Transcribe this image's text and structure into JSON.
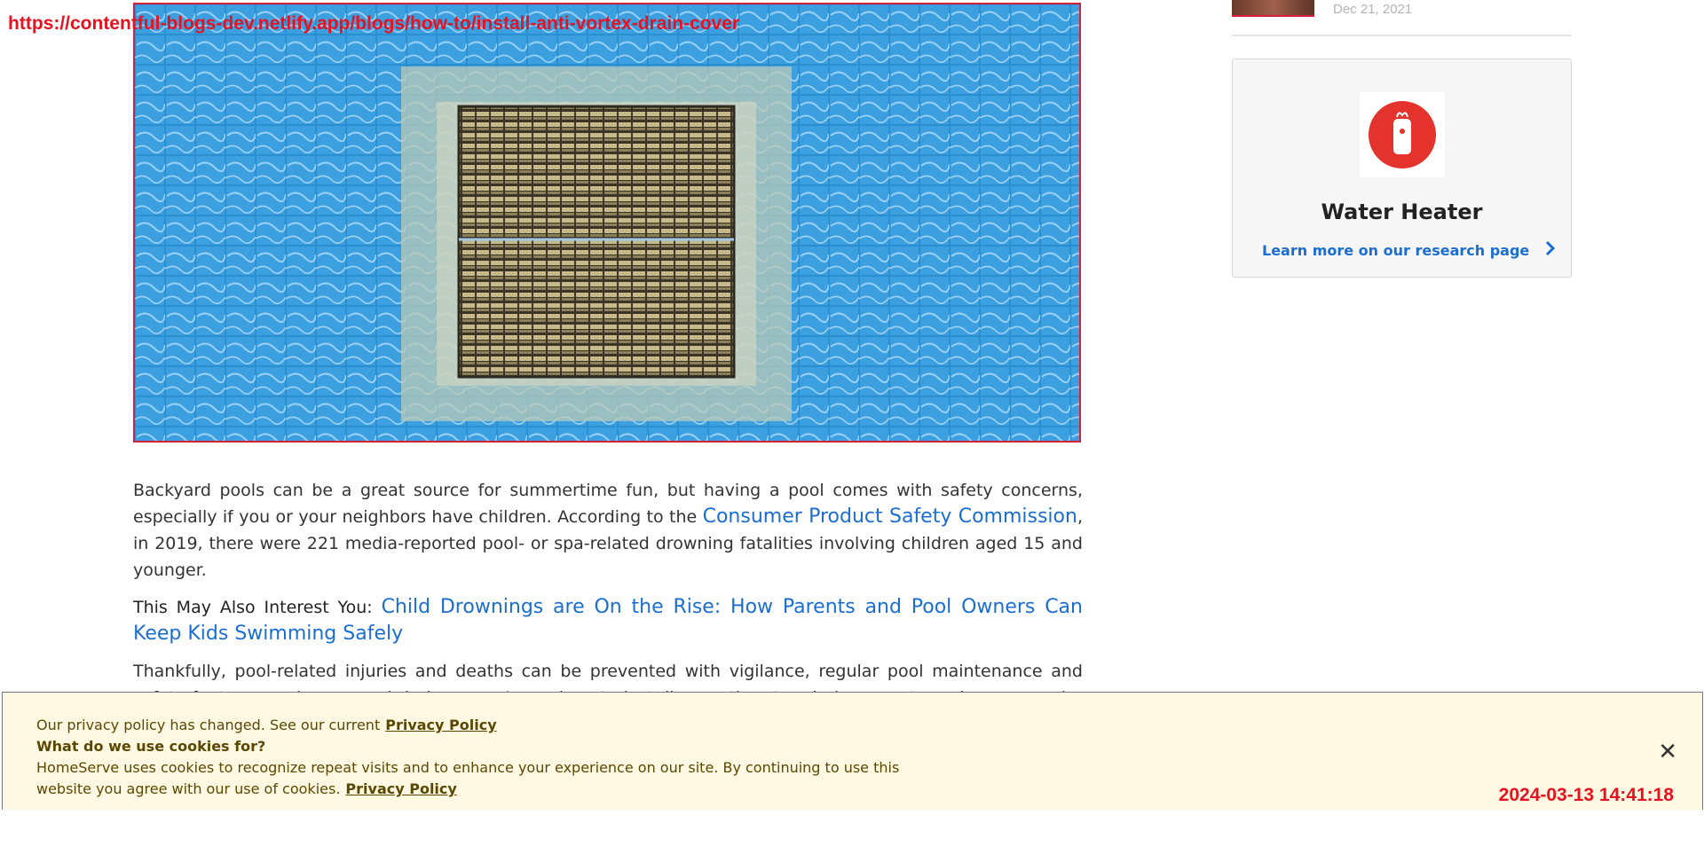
{
  "overlay": {
    "url": "https://contentful-blogs-dev.netlify.app/blogs/how-to/install-anti-vortex-drain-cover",
    "timestamp": "2024-03-13 14:41:18"
  },
  "article": {
    "p1_before": "Backyard pools can be a great source for summertime fun, but having a pool comes with safety concerns, especially if you or your neighbors have children. According to the ",
    "p1_link": "Consumer Product Safety Commission",
    "p1_after": ", in 2019, there were 221 media-reported pool- or spa-related drowning fatalities involving children aged 15 and younger.",
    "also_label": "This May Also Interest You: ",
    "also_link": "Child Drownings are On the Rise: How Parents and Pool Owners Can Keep Kids Swimming Safely",
    "p3": "Thankfully, pool-related injuries and deaths can be prevented with vigilance, regular pool maintenance and safety features such as a pool drain cover. Learn how to install an anti-vortex drain cover to make your pool a safer place to"
  },
  "sidebar": {
    "date": "Dec 21, 2021",
    "card": {
      "icon": "water-heater-icon",
      "title": "Water Heater",
      "link_label": "Learn more on our research page"
    }
  },
  "cookie": {
    "line1": "Our privacy policy has changed. See our current",
    "privacy_link": "Privacy Policy",
    "question": "What do we use cookies for?",
    "body": "HomeServe uses cookies to recognize repeat visits and to enhance your experience on our site. By continuing to use this website you agree with our use of cookies.",
    "close": "✕"
  },
  "colors": {
    "accent": "#d4203a",
    "link": "#1b6ed1",
    "cookie_bg": "#fff9e3"
  }
}
